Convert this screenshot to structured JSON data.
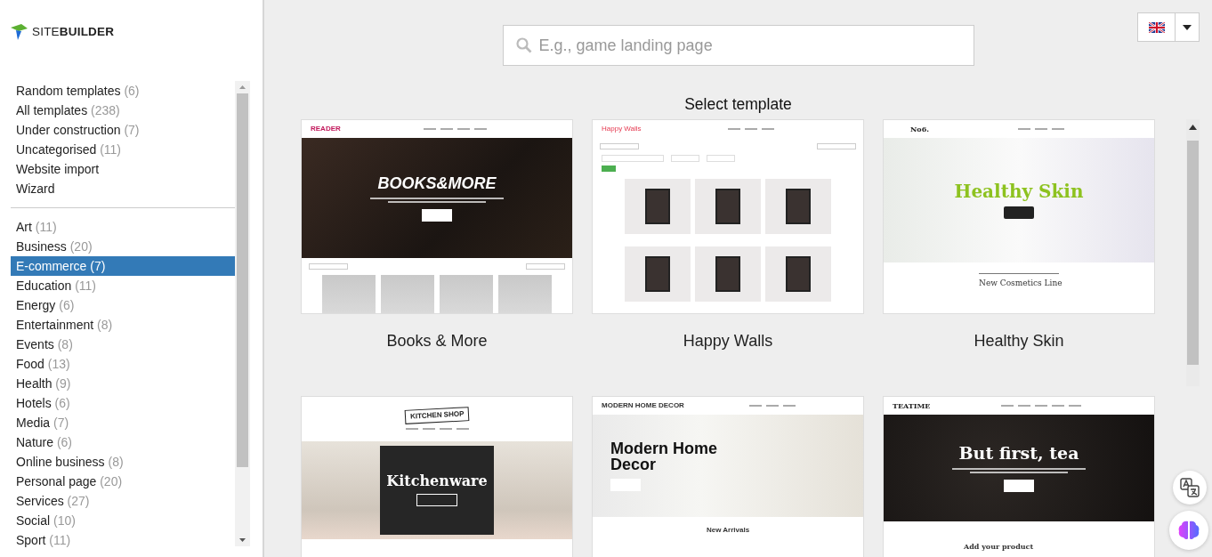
{
  "logo": {
    "text": "SITE**BUILDER**"
  },
  "sidebar": {
    "groups": [
      [
        {
          "label": "Random templates",
          "count": "(6)",
          "selected": false
        },
        {
          "label": "All templates",
          "count": "(238)",
          "selected": false
        },
        {
          "label": "Under construction",
          "count": "(7)",
          "selected": false
        },
        {
          "label": "Uncategorised",
          "count": "(11)",
          "selected": false
        },
        {
          "label": "Website import",
          "selected": false
        },
        {
          "label": "Wizard",
          "selected": false
        }
      ],
      [
        {
          "label": "Art",
          "count": "(11)",
          "selected": false
        },
        {
          "label": "Business",
          "count": "(20)",
          "selected": false
        },
        {
          "label": "E-commerce",
          "count": "(7)",
          "selected": true
        },
        {
          "label": "Education",
          "count": "(11)",
          "selected": false
        },
        {
          "label": "Energy",
          "count": "(6)",
          "selected": false
        },
        {
          "label": "Entertainment",
          "count": "(8)",
          "selected": false
        },
        {
          "label": "Events",
          "count": "(8)",
          "selected": false
        },
        {
          "label": "Food",
          "count": "(13)",
          "selected": false
        },
        {
          "label": "Health",
          "count": "(9)",
          "selected": false
        },
        {
          "label": "Hotels",
          "count": "(6)",
          "selected": false
        },
        {
          "label": "Media",
          "count": "(7)",
          "selected": false
        },
        {
          "label": "Nature",
          "count": "(6)",
          "selected": false
        },
        {
          "label": "Online business",
          "count": "(8)",
          "selected": false
        },
        {
          "label": "Personal page",
          "count": "(20)",
          "selected": false
        },
        {
          "label": "Services",
          "count": "(27)",
          "selected": false
        },
        {
          "label": "Social",
          "count": "(10)",
          "selected": false
        },
        {
          "label": "Sport",
          "count": "(11)",
          "selected": false
        }
      ]
    ]
  },
  "search": {
    "placeholder": "E.g., game landing page"
  },
  "heading": "Select template",
  "templates": [
    {
      "name": "Books & More",
      "preview": {
        "kind": "hero-dark",
        "brand": "READER",
        "headline": "BOOKS&MORE"
      }
    },
    {
      "name": "Happy Walls",
      "preview": {
        "kind": "catalog",
        "brand": "Happy Walls"
      }
    },
    {
      "name": "Healthy Skin",
      "preview": {
        "kind": "hero-light",
        "brand": "No6.",
        "headline": "Healthy Skin",
        "section": "New Cosmetics Line"
      }
    },
    {
      "preview": {
        "kind": "boxed",
        "brand": "KITCHEN SHOP",
        "headline": "Kitchenware"
      }
    },
    {
      "preview": {
        "kind": "hero-left",
        "brand": "MODERN HOME DECOR",
        "headline": "Modern Home Decor",
        "section": "New Arrivals"
      }
    },
    {
      "preview": {
        "kind": "hero-tea",
        "brand": "TEATIME",
        "headline": "But first, tea",
        "section": "Add your product"
      }
    }
  ]
}
